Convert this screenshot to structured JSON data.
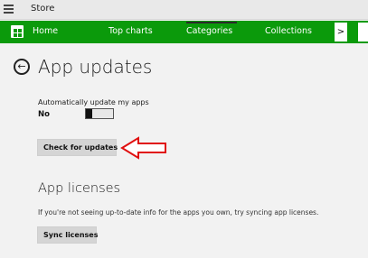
{
  "window": {
    "title": "Store"
  },
  "nav": {
    "items": [
      {
        "label": "Home"
      },
      {
        "label": "Top charts"
      },
      {
        "label": "Categories"
      },
      {
        "label": "Collections"
      }
    ],
    "more_glyph": ">"
  },
  "page": {
    "title": "App updates"
  },
  "auto_update": {
    "label": "Automatically update my apps",
    "value": "No",
    "enabled": false
  },
  "check_button": {
    "label": "Check for updates"
  },
  "licenses": {
    "title": "App licenses",
    "description": "If you're not seeing up-to-date info for the apps you own, try syncing app licenses.",
    "sync_label": "Sync licenses"
  },
  "colors": {
    "nav_bg": "#0b9a0b",
    "annotation_arrow": "#e01010"
  },
  "icons": [
    "hamburger-icon",
    "store-bag-icon",
    "back-arrow-icon",
    "chevron-right-icon",
    "search-icon",
    "annotation-arrow-icon"
  ]
}
